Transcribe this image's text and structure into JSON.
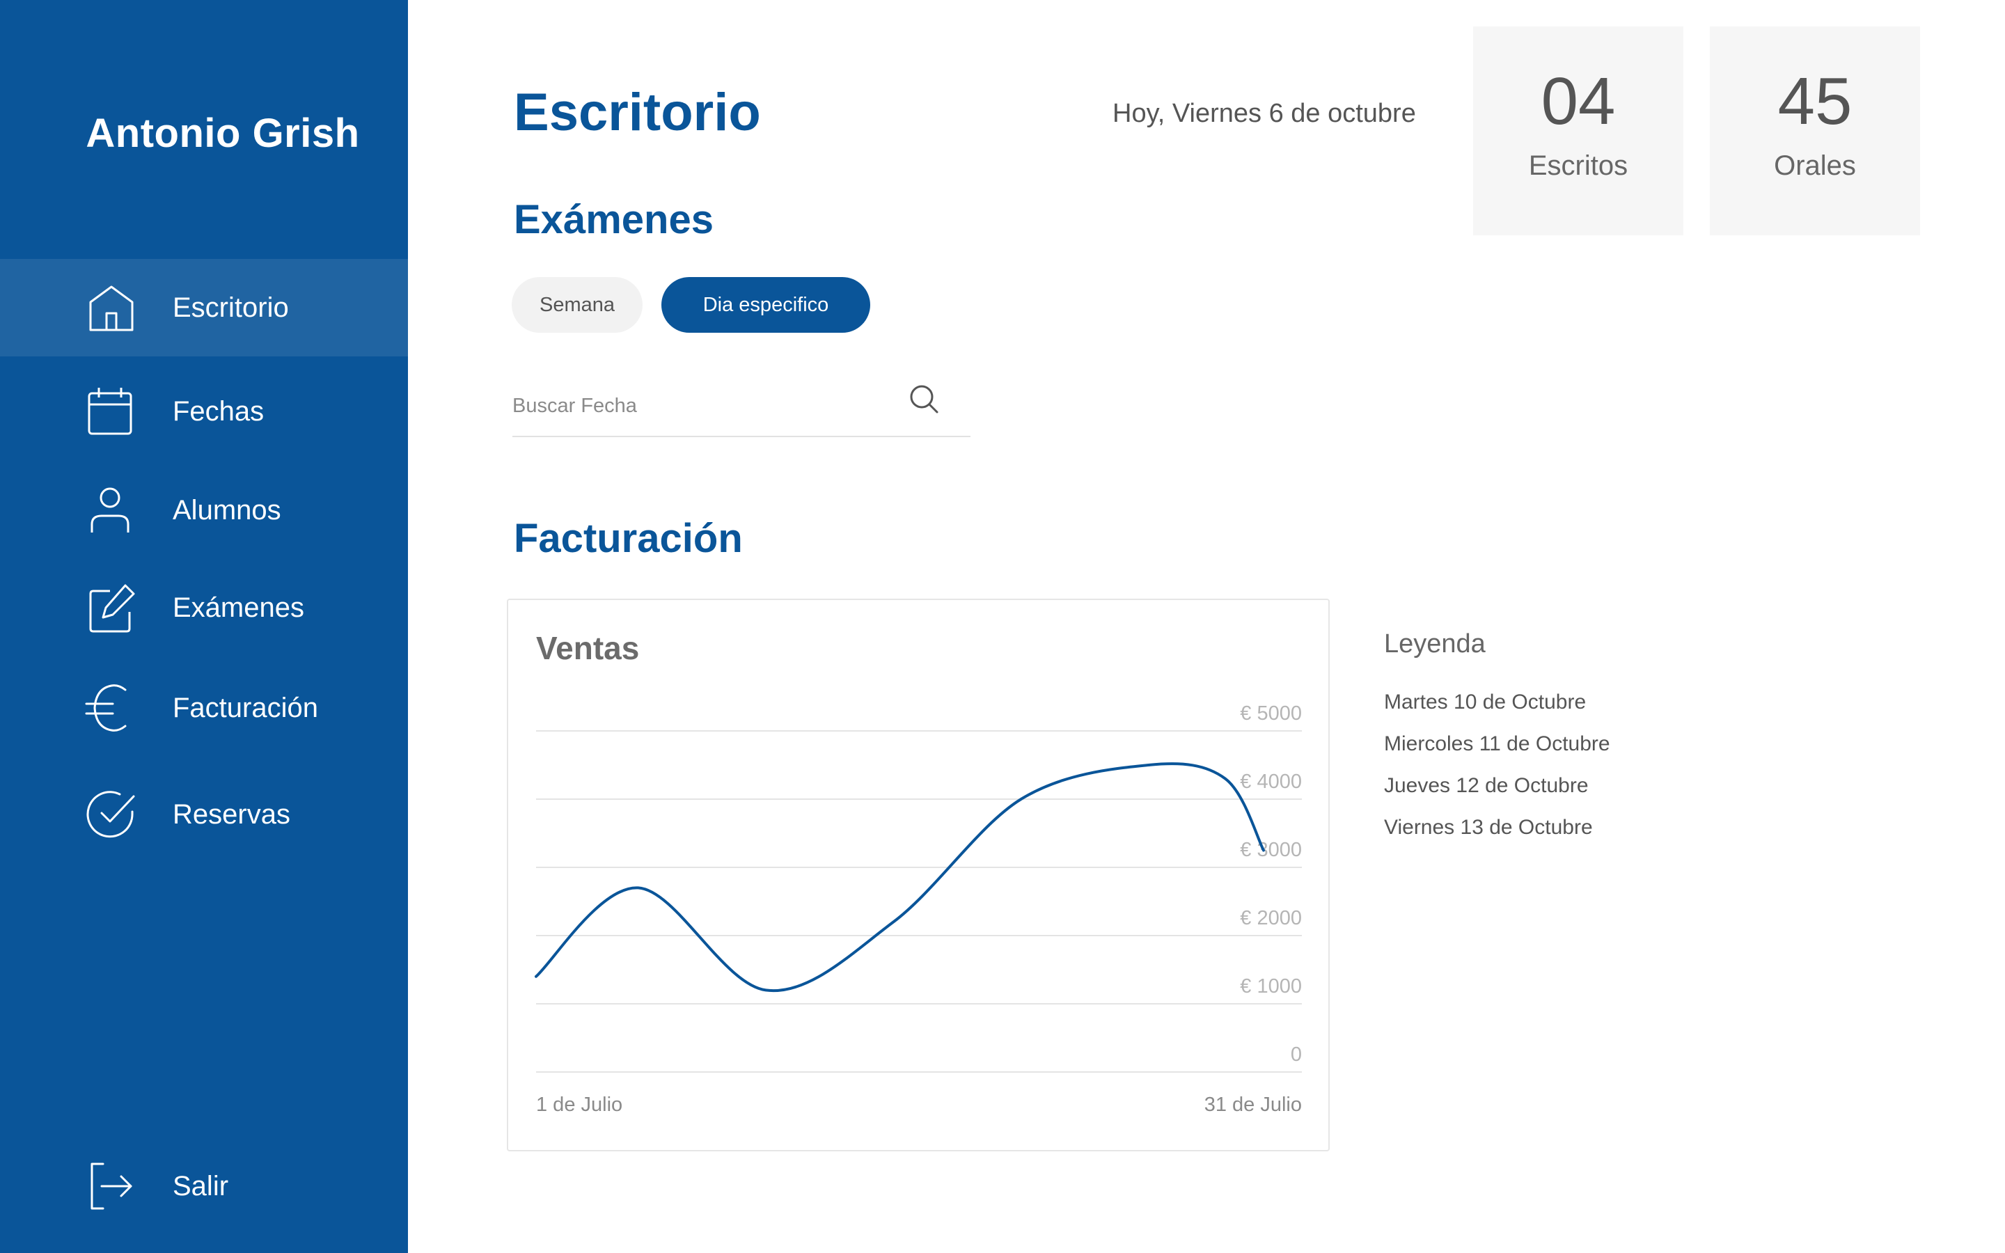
{
  "user": {
    "name": "Antonio Grish"
  },
  "sidebar": {
    "items": [
      {
        "label": "Escritorio",
        "icon": "home-icon",
        "active": true
      },
      {
        "label": "Fechas",
        "icon": "calendar-icon"
      },
      {
        "label": "Alumnos",
        "icon": "user-icon"
      },
      {
        "label": "Exámenes",
        "icon": "edit-icon"
      },
      {
        "label": "Facturación",
        "icon": "euro-icon"
      },
      {
        "label": "Reservas",
        "icon": "check-circle-icon"
      }
    ],
    "logout": {
      "label": "Salir",
      "icon": "logout-icon"
    }
  },
  "header": {
    "title": "Escritorio",
    "date": "Hoy, Viernes 6 de octubre",
    "stats": [
      {
        "value": "04",
        "label": "Escritos"
      },
      {
        "value": "45",
        "label": "Orales"
      }
    ]
  },
  "exams": {
    "title": "Exámenes",
    "filters": [
      {
        "label": "Semana",
        "active": false
      },
      {
        "label": "Dia especifico",
        "active": true
      }
    ],
    "search": {
      "placeholder": "Buscar Fecha",
      "value": ""
    }
  },
  "billing": {
    "title": "Facturación",
    "legend": {
      "title": "Leyenda",
      "items": [
        "Martes 10 de Octubre",
        "Miercoles 11 de Octubre",
        "Jueves 12 de Octubre",
        "Viernes 13 de Octubre"
      ]
    }
  },
  "colors": {
    "primary": "#0a5599",
    "sidebar_bg": "#0a5599",
    "card_bg": "#f6f6f6"
  },
  "chart_data": {
    "type": "line",
    "title": "Ventas",
    "x_labels": [
      "1 de Julio",
      "31 de Julio"
    ],
    "y_tick_labels": [
      "€ 5000",
      "€ 4000",
      "€ 3000",
      "€ 2000",
      "€ 1000",
      "0"
    ],
    "ylim": [
      0,
      5000
    ],
    "xlim": [
      1,
      31
    ],
    "grid": true,
    "series": [
      {
        "color": "#0a5599",
        "x": [
          1,
          5,
          10,
          15,
          20,
          25,
          28,
          29.5
        ],
        "y": [
          1400,
          2700,
          1200,
          2200,
          4000,
          4500,
          4300,
          3250
        ]
      }
    ]
  }
}
